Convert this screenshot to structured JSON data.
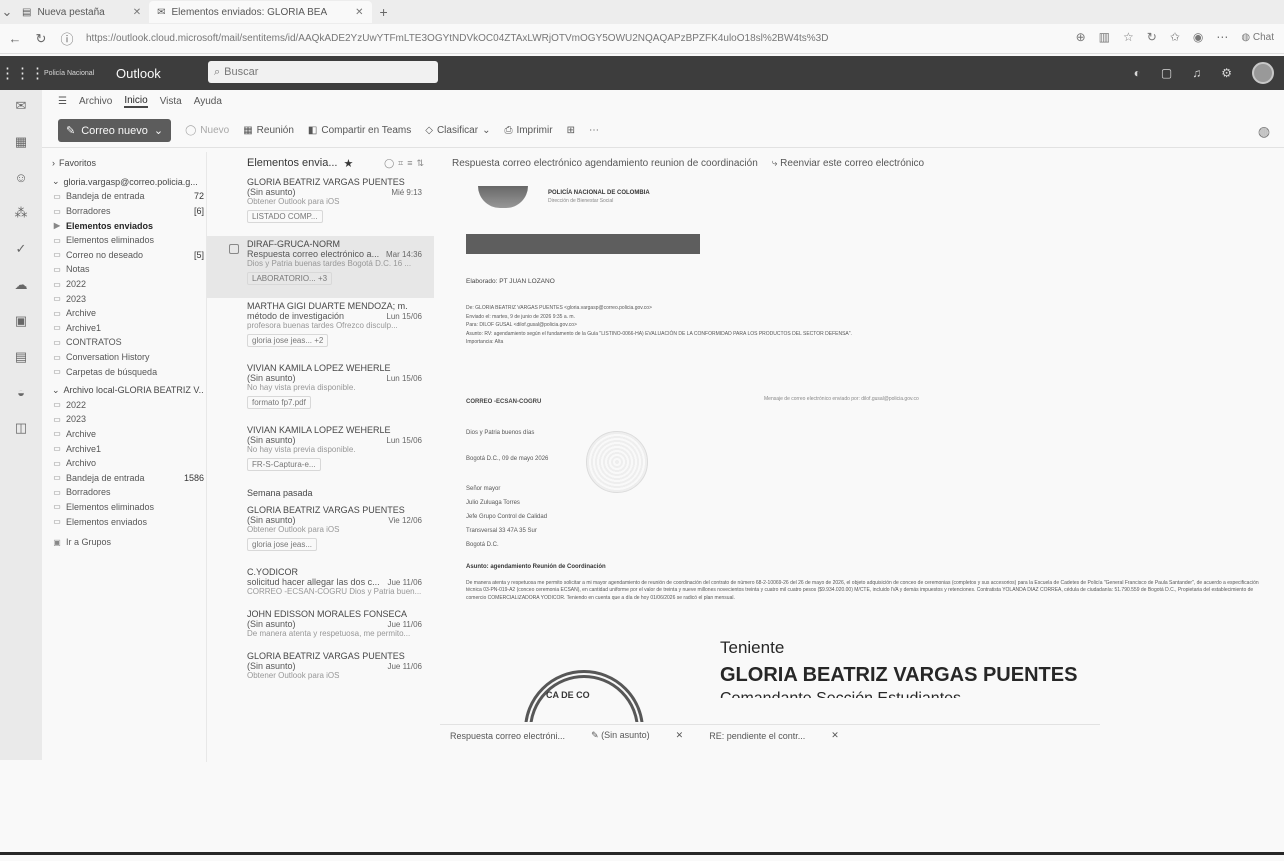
{
  "browser": {
    "tabs": [
      {
        "label": "Nueva pestaña"
      },
      {
        "label": "Elementos enviados: GLORIA BEA"
      }
    ],
    "url": "https://outlook.cloud.microsoft/mail/sentitems/id/AAQkADE2YzUwYTFmLTE3OGYtNDVkOC04ZTAxLWRjOTVmOGY5OWU2NQAQAPzBPZFK4uloO18sl%2BW4ts%3D",
    "chat_label": "Chat"
  },
  "outlook": {
    "org_name": "Policía Nacional",
    "brand": "Outlook",
    "search_placeholder": "Buscar",
    "menu": [
      "Archivo",
      "Inicio",
      "Vista",
      "Ayuda"
    ],
    "ribbon": {
      "new_mail": "Correo nuevo",
      "items": [
        "Nuevo",
        "Reunión",
        "Compartir en Teams",
        "Clasificar",
        "Imprimir"
      ]
    }
  },
  "folders": {
    "favorites": "Favoritos",
    "account": "gloria.vargasp@correo.policia.g...",
    "items": [
      {
        "label": "Bandeja de entrada",
        "count": "72"
      },
      {
        "label": "Borradores",
        "count": "[6]"
      },
      {
        "label": "Elementos enviados",
        "count": ""
      },
      {
        "label": "Elementos eliminados",
        "count": ""
      },
      {
        "label": "Correo no deseado",
        "count": "[5]"
      },
      {
        "label": "Notas",
        "count": ""
      },
      {
        "label": "2022",
        "count": ""
      },
      {
        "label": "2023",
        "count": ""
      },
      {
        "label": "Archive",
        "count": ""
      },
      {
        "label": "Archive1",
        "count": ""
      },
      {
        "label": "CONTRATOS",
        "count": ""
      },
      {
        "label": "Conversation History",
        "count": ""
      },
      {
        "label": "Carpetas de búsqueda",
        "count": ""
      }
    ],
    "archive_header": "Archivo local-GLORIA BEATRIZ V...",
    "archive_items": [
      {
        "label": "2022",
        "count": ""
      },
      {
        "label": "2023",
        "count": ""
      },
      {
        "label": "Archive",
        "count": ""
      },
      {
        "label": "Archive1",
        "count": ""
      },
      {
        "label": "Archivo",
        "count": ""
      },
      {
        "label": "Bandeja de entrada",
        "count": "1586"
      },
      {
        "label": "Borradores",
        "count": ""
      },
      {
        "label": "Elementos eliminados",
        "count": ""
      },
      {
        "label": "Elementos enviados",
        "count": ""
      }
    ],
    "groups": "Ir a Grupos"
  },
  "messages": {
    "header": "Elementos envia...",
    "list": [
      {
        "from": "GLORIA BEATRIZ VARGAS PUENTES",
        "subject": "(Sin asunto)",
        "preview": "Obtener Outlook para iOS",
        "date": "Mié 9:13",
        "att": "LISTADO COMP..."
      },
      {
        "from": "DIRAF-GRUCA-NORM",
        "subject": "Respuesta correo electrónico a...",
        "preview": "Dios y Patria buenas tardes Bogotá D.C. 16 ...",
        "date": "Mar 14:36",
        "att": "LABORATORIO... +3"
      },
      {
        "from": "MARTHA GIGI DUARTE MENDOZA; m...",
        "subject": "método de investigación",
        "preview": "profesora buenas tardes Ofrezco disculp...",
        "date": "Lun 15/06",
        "att": "gloria jose jeas... +2"
      },
      {
        "from": "VIVIAN KAMILA LOPEZ WEHERLE",
        "subject": "(Sin asunto)",
        "preview": "No hay vista previa disponible.",
        "date": "Lun 15/06",
        "att": "formato fp7.pdf"
      },
      {
        "from": "VIVIAN KAMILA LOPEZ WEHERLE",
        "subject": "(Sin asunto)",
        "preview": "No hay vista previa disponible.",
        "date": "Lun 15/06",
        "att": "FR-S-Captura-e..."
      }
    ],
    "group_label": "Semana pasada",
    "list2": [
      {
        "from": "GLORIA BEATRIZ VARGAS PUENTES",
        "subject": "(Sin asunto)",
        "preview": "Obtener Outlook para iOS",
        "date": "Vie 12/06",
        "att": "gloria jose jeas..."
      },
      {
        "from": "C.YODICOR",
        "subject": "solicitud hacer allegar las dos c...",
        "preview": "CORREO -ECSAN-COGRU Dios y Patria buen...",
        "date": "Jue 11/06",
        "att": ""
      },
      {
        "from": "JOHN EDISSON MORALES FONSECA",
        "subject": "(Sin asunto)",
        "preview": "De manera atenta y respetuosa, me permito...",
        "date": "Jue 11/06",
        "att": ""
      },
      {
        "from": "GLORIA BEATRIZ VARGAS PUENTES",
        "subject": "(Sin asunto)",
        "preview": "Obtener Outlook para iOS",
        "date": "Jue 11/06",
        "att": ""
      }
    ]
  },
  "reading": {
    "subject": "Respuesta correo electrónico agendamiento reunion de coordinación",
    "forward": "Reenviar este correo electrónico",
    "org": "POLICÍA NACIONAL DE COLOMBIA",
    "org_sub": "Dirección de Bienestar Social",
    "elaborado": "Elaborado: PT JUAN LOZANO",
    "headers": [
      "De: GLORIA BEATRIZ VARGAS PUENTES <gloria.vargasp@correo.policia.gov.co>",
      "Enviado el: martes, 9 de junio de 2026 9:35 a. m.",
      "Para: DILOF GUSAL <dilof.gusal@policia.gov.co>",
      "Asunto: RV: agendamiento según el fundamento de la Guía \"LISTINO-0066-HA) EVALUACIÓN DE LA CONFORMIDAD PARA LOS PRODUCTOS DEL SECTOR DEFENSA\".",
      "Importancia: Alta"
    ],
    "note": "Mensaje de correo electrónico enviado por: dilof.gusal@policia.gov.co",
    "correo_tag": "CORREO -ECSAN-COGRU",
    "greeting": "Dios y Patria buenos días",
    "date_line": "Bogotá D.C., 09 de mayo 2026",
    "addr": [
      "Señor mayor",
      "Julio Zuluaga Torres",
      "Jefe Grupo Control de Calidad",
      "Transversal 33 47A 35 Sur",
      "Bogotá D.C."
    ],
    "asunto": "Asunto: agendamiento Reunión de Coordinación",
    "body": "De manera atenta y respetuosa me permito solicitar a mi mayor agendamiento de reunión de coordinación del contrato de número 68-2-10069-26 del 26 de mayo de 2026, el objeto adquisición de conceo de ceremonias (completos y sus accesorios) para la Escuela de Cadetes de Policía \"General Francisco de Paula Santander\", de acuerdo a especificación técnica 03-PN-019-A2 (conceo ceremonia ECSAN), en cantidad uniforme por el valor de treinta y nueve millones novecientos treinta y cuatro mil cuatro pesos ($9.934.020.00) M/CTE, incluido IVA y demás impuestos y retenciones. Contratista YOLANDA DIAZ CORREA, cédula de ciudadanía: 51.790.559 de Bogotá D.C., Propietaria del establecimiento de comercio COMERCIALIZADORA YODICOR. Teniendo en cuenta que a día de hoy 01/06/2026 se radicó el plan mensual.",
    "sig_rank": "Teniente",
    "sig_name": "GLORIA BEATRIZ VARGAS PUENTES",
    "sig_role_cut": "Comandante Sección Estudiantes",
    "seal_text": "CA DE CO"
  },
  "drafts": {
    "tabs": [
      "Respuesta correo electróni...",
      "(Sin asunto)",
      "RE: pendiente el contr..."
    ]
  }
}
